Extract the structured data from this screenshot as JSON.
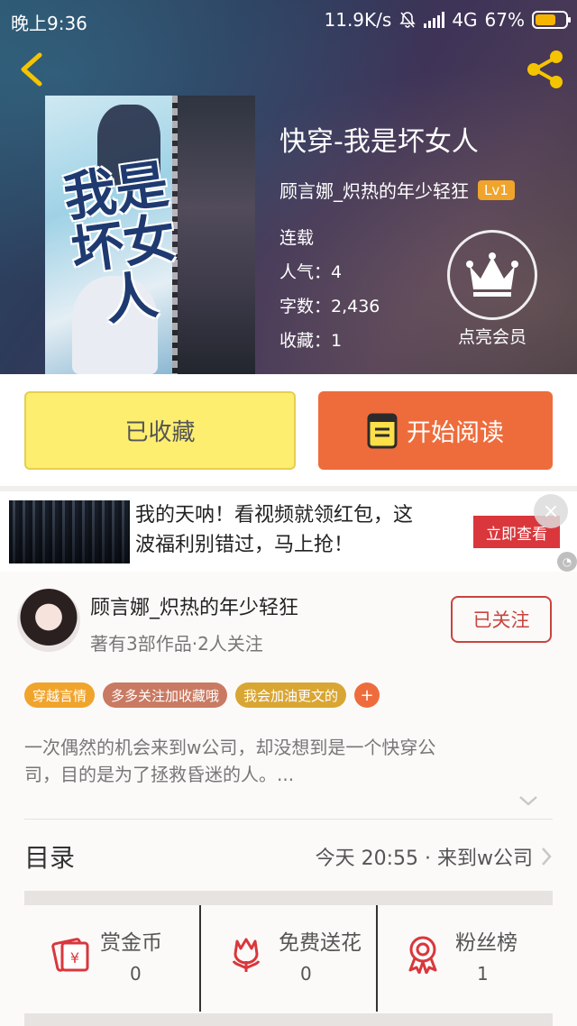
{
  "status_bar": {
    "time": "晚上9:36",
    "net_speed": "11.9K/s",
    "network": "4G",
    "battery": "67%"
  },
  "book": {
    "cover_title_art": "我是坏女人",
    "title": "快穿-我是坏女人",
    "author": "顾言娜_炽热的年少轻狂",
    "author_level": "Lv1",
    "status": "连载",
    "popularity": "人气：4",
    "word_count": "字数：2,436",
    "favorites": "收藏：1"
  },
  "vip": {
    "label": "点亮会员"
  },
  "actions": {
    "favorited_label": "已收藏",
    "read_label": "开始阅读"
  },
  "ad": {
    "line1": "我的天呐！看视频就领红包，这",
    "line2": "波福利别错过，马上抢！",
    "cta": "立即查看",
    "close": "×"
  },
  "author_card": {
    "name": "顾言娜_炽热的年少轻狂",
    "stats": "著有3部作品·2人关注",
    "follow_label": "已关注"
  },
  "tags": [
    {
      "label": "穿越言情",
      "color": "#f0a42c"
    },
    {
      "label": "多多关注加收藏哦",
      "color": "#c97a62"
    },
    {
      "label": "我会加油更文的",
      "color": "#d9a634"
    }
  ],
  "tag_add": "+",
  "description": {
    "line1": "一次偶然的机会来到w公司，却没想到是一个快穿公",
    "line2": "司，目的是为了拯救昏迷的人。..."
  },
  "toc": {
    "title": "目录",
    "latest": "今天 20:55 · 来到w公司"
  },
  "rewards": [
    {
      "label": "赏金币",
      "value": "0",
      "icon": "red-envelope-icon"
    },
    {
      "label": "免费送花",
      "value": "0",
      "icon": "flower-icon"
    },
    {
      "label": "粉丝榜",
      "value": "1",
      "icon": "medal-icon"
    }
  ],
  "colors": {
    "accent_orange": "#ee6c3c",
    "favorited_yellow": "#fdee70",
    "follow_red": "#c9443d",
    "icon_red": "#d9373c"
  }
}
